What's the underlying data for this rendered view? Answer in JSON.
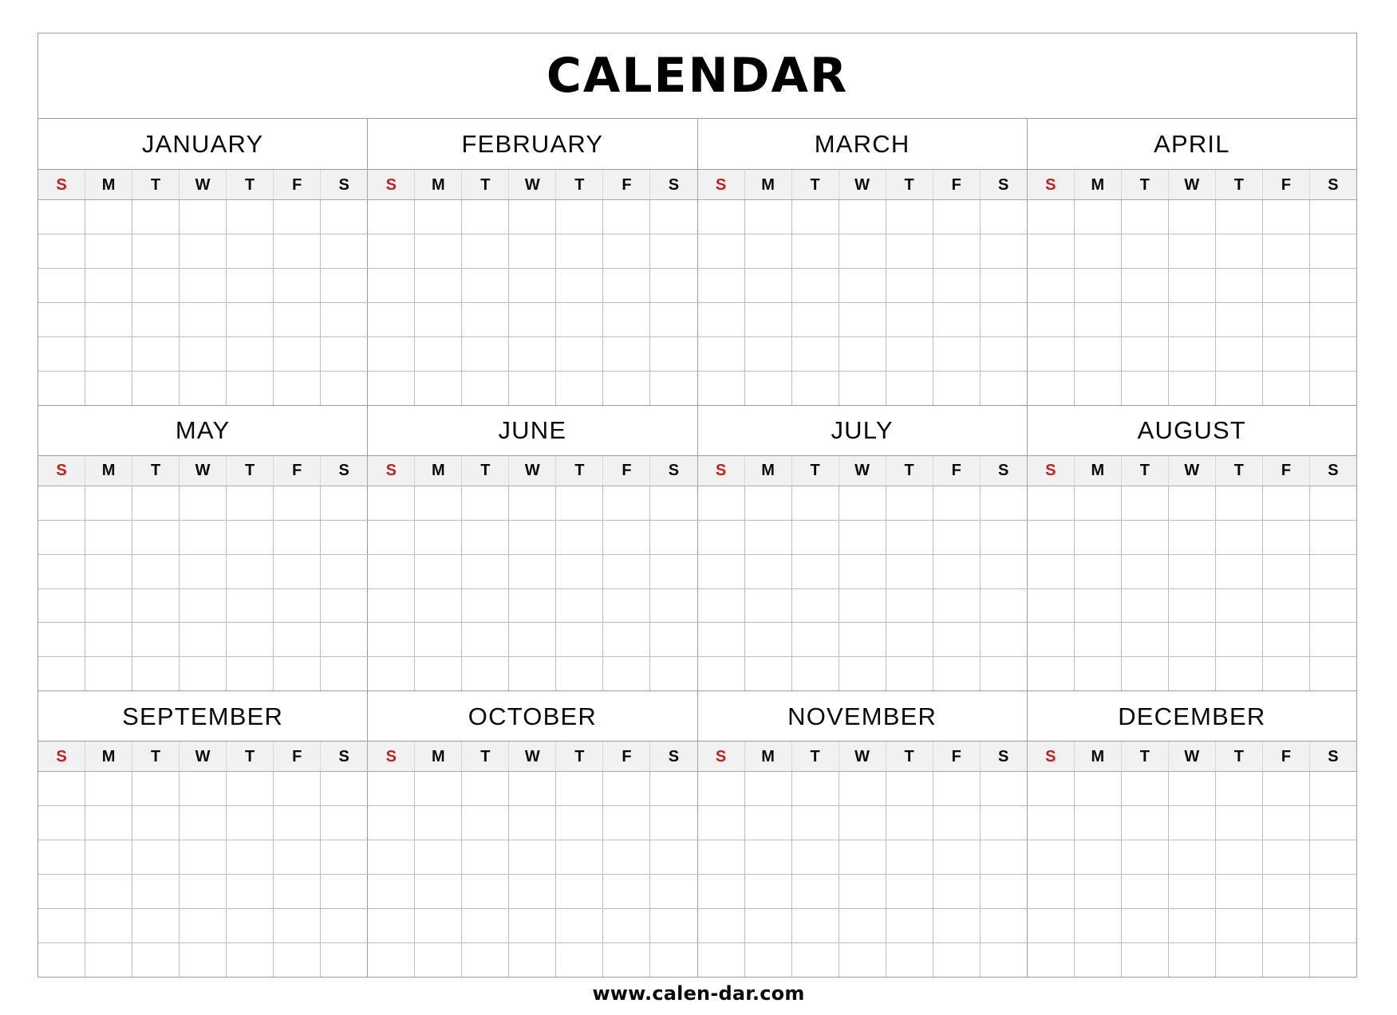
{
  "document": {
    "title": "CALENDAR",
    "footer_url": "www.calen-dar.com"
  },
  "colors": {
    "sunday_red": "#c0201e",
    "text_black": "#0a0a0a",
    "grid_line": "#bcbcbc",
    "frame_line": "#9a9a9a",
    "weekday_header_bg": "#f1f1f1",
    "page_bg": "#ffffff"
  },
  "weekday_initials": [
    "S",
    "M",
    "T",
    "W",
    "T",
    "F",
    "S"
  ],
  "grid": {
    "weeks_per_month": 6,
    "days_per_week": 7,
    "months_per_row": 4,
    "quarters": 3,
    "day_numbers_filled": false
  },
  "quarters": [
    {
      "index": 1,
      "months": [
        {
          "name": "JANUARY",
          "days": [
            "",
            "",
            "",
            "",
            "",
            "",
            "",
            "",
            "",
            "",
            "",
            "",
            "",
            "",
            "",
            "",
            "",
            "",
            "",
            "",
            "",
            "",
            "",
            "",
            "",
            "",
            "",
            "",
            "",
            "",
            "",
            "",
            "",
            "",
            "",
            "",
            "",
            "",
            "",
            "",
            "",
            ""
          ]
        },
        {
          "name": "FEBRUARY",
          "days": [
            "",
            "",
            "",
            "",
            "",
            "",
            "",
            "",
            "",
            "",
            "",
            "",
            "",
            "",
            "",
            "",
            "",
            "",
            "",
            "",
            "",
            "",
            "",
            "",
            "",
            "",
            "",
            "",
            "",
            "",
            "",
            "",
            "",
            "",
            "",
            "",
            "",
            "",
            "",
            "",
            "",
            ""
          ]
        },
        {
          "name": "MARCH",
          "days": [
            "",
            "",
            "",
            "",
            "",
            "",
            "",
            "",
            "",
            "",
            "",
            "",
            "",
            "",
            "",
            "",
            "",
            "",
            "",
            "",
            "",
            "",
            "",
            "",
            "",
            "",
            "",
            "",
            "",
            "",
            "",
            "",
            "",
            "",
            "",
            "",
            "",
            "",
            "",
            "",
            "",
            ""
          ]
        },
        {
          "name": "APRIL",
          "days": [
            "",
            "",
            "",
            "",
            "",
            "",
            "",
            "",
            "",
            "",
            "",
            "",
            "",
            "",
            "",
            "",
            "",
            "",
            "",
            "",
            "",
            "",
            "",
            "",
            "",
            "",
            "",
            "",
            "",
            "",
            "",
            "",
            "",
            "",
            "",
            "",
            "",
            "",
            "",
            "",
            "",
            ""
          ]
        }
      ]
    },
    {
      "index": 2,
      "months": [
        {
          "name": "MAY",
          "days": [
            "",
            "",
            "",
            "",
            "",
            "",
            "",
            "",
            "",
            "",
            "",
            "",
            "",
            "",
            "",
            "",
            "",
            "",
            "",
            "",
            "",
            "",
            "",
            "",
            "",
            "",
            "",
            "",
            "",
            "",
            "",
            "",
            "",
            "",
            "",
            "",
            "",
            "",
            "",
            "",
            "",
            ""
          ]
        },
        {
          "name": "JUNE",
          "days": [
            "",
            "",
            "",
            "",
            "",
            "",
            "",
            "",
            "",
            "",
            "",
            "",
            "",
            "",
            "",
            "",
            "",
            "",
            "",
            "",
            "",
            "",
            "",
            "",
            "",
            "",
            "",
            "",
            "",
            "",
            "",
            "",
            "",
            "",
            "",
            "",
            "",
            "",
            "",
            "",
            "",
            ""
          ]
        },
        {
          "name": "JULY",
          "days": [
            "",
            "",
            "",
            "",
            "",
            "",
            "",
            "",
            "",
            "",
            "",
            "",
            "",
            "",
            "",
            "",
            "",
            "",
            "",
            "",
            "",
            "",
            "",
            "",
            "",
            "",
            "",
            "",
            "",
            "",
            "",
            "",
            "",
            "",
            "",
            "",
            "",
            "",
            "",
            "",
            "",
            ""
          ]
        },
        {
          "name": "AUGUST",
          "days": [
            "",
            "",
            "",
            "",
            "",
            "",
            "",
            "",
            "",
            "",
            "",
            "",
            "",
            "",
            "",
            "",
            "",
            "",
            "",
            "",
            "",
            "",
            "",
            "",
            "",
            "",
            "",
            "",
            "",
            "",
            "",
            "",
            "",
            "",
            "",
            "",
            "",
            "",
            "",
            "",
            "",
            ""
          ]
        }
      ]
    },
    {
      "index": 3,
      "months": [
        {
          "name": "SEPTEMBER",
          "days": [
            "",
            "",
            "",
            "",
            "",
            "",
            "",
            "",
            "",
            "",
            "",
            "",
            "",
            "",
            "",
            "",
            "",
            "",
            "",
            "",
            "",
            "",
            "",
            "",
            "",
            "",
            "",
            "",
            "",
            "",
            "",
            "",
            "",
            "",
            "",
            "",
            "",
            "",
            "",
            "",
            "",
            ""
          ]
        },
        {
          "name": "OCTOBER",
          "days": [
            "",
            "",
            "",
            "",
            "",
            "",
            "",
            "",
            "",
            "",
            "",
            "",
            "",
            "",
            "",
            "",
            "",
            "",
            "",
            "",
            "",
            "",
            "",
            "",
            "",
            "",
            "",
            "",
            "",
            "",
            "",
            "",
            "",
            "",
            "",
            "",
            "",
            "",
            "",
            "",
            "",
            ""
          ]
        },
        {
          "name": "NOVEMBER",
          "days": [
            "",
            "",
            "",
            "",
            "",
            "",
            "",
            "",
            "",
            "",
            "",
            "",
            "",
            "",
            "",
            "",
            "",
            "",
            "",
            "",
            "",
            "",
            "",
            "",
            "",
            "",
            "",
            "",
            "",
            "",
            "",
            "",
            "",
            "",
            "",
            "",
            "",
            "",
            "",
            "",
            "",
            ""
          ]
        },
        {
          "name": "DECEMBER",
          "days": [
            "",
            "",
            "",
            "",
            "",
            "",
            "",
            "",
            "",
            "",
            "",
            "",
            "",
            "",
            "",
            "",
            "",
            "",
            "",
            "",
            "",
            "",
            "",
            "",
            "",
            "",
            "",
            "",
            "",
            "",
            "",
            "",
            "",
            "",
            "",
            "",
            "",
            "",
            "",
            "",
            "",
            ""
          ]
        }
      ]
    }
  ]
}
